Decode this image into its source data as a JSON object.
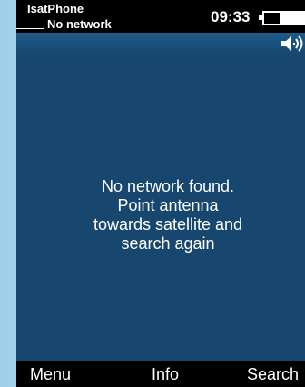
{
  "status_bar": {
    "operator": "IsatPhone",
    "network": "No network",
    "time": "09:33"
  },
  "icons": {
    "speaker": "speaker-volume-icon",
    "battery": "battery-icon"
  },
  "message": {
    "line1": "No network found.",
    "line2": "Point antenna",
    "line3": "towards satellite and",
    "line4": "search again"
  },
  "softkeys": {
    "left": "Menu",
    "center": "Info",
    "right": "Search"
  },
  "colors": {
    "screen_background": "#17476e",
    "status_background": "#000000",
    "text": "#ffffff"
  }
}
